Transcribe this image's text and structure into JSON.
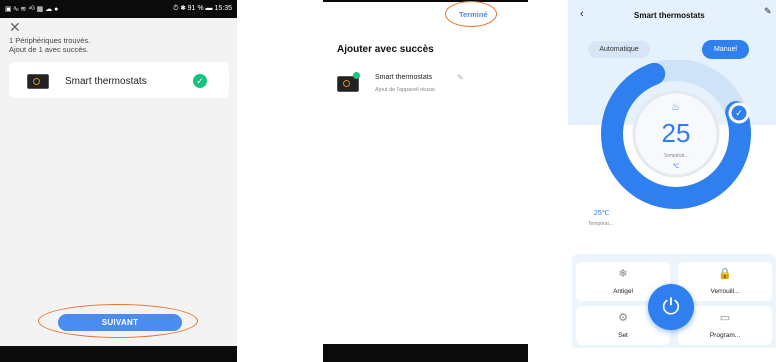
{
  "panel1": {
    "statusbar": {
      "left_icons": "▣ ᵃₗₗ ≋ ⁴ᴳ ▦ ☁ ●",
      "right": "⏱ ✱ 91 % ▬ 15:35"
    },
    "found_line1": "1 Périphériques trouvés.",
    "found_line2": "Ajout de 1 avec succès.",
    "device_name": "Smart thermostats",
    "next_button": "SUIVANT",
    "colors": {
      "accent": "#4a8cf0",
      "success": "#19c27e",
      "highlight": "#e8742a"
    }
  },
  "panel2": {
    "done_button": "Terminé",
    "title": "Ajouter avec succès",
    "device_name": "Smart thermostats",
    "device_status": "Ajout de l'appareil réussi"
  },
  "panel3": {
    "title": "Smart thermostats",
    "mode_auto": "Automatique",
    "mode_manual": "Manuel",
    "setpoint": "25",
    "setpoint_label": "Températ...",
    "unit": "℃",
    "current_temp": "25℃",
    "current_label": "Températ...",
    "dial_fill_fraction": 0.75,
    "tiles": [
      {
        "label": "Antigel",
        "icon": "snowflake-icon",
        "glyph": "❄"
      },
      {
        "label": "Verrouill...",
        "icon": "lock-icon",
        "glyph": "🔒"
      },
      {
        "label": "Set",
        "icon": "gear-icon",
        "glyph": "⚙"
      },
      {
        "label": "Program...",
        "icon": "monitor-icon",
        "glyph": "▭"
      }
    ],
    "power_glyph": "⏻",
    "colors": {
      "primary": "#2f80ee",
      "background": "#e5f1fd"
    }
  }
}
